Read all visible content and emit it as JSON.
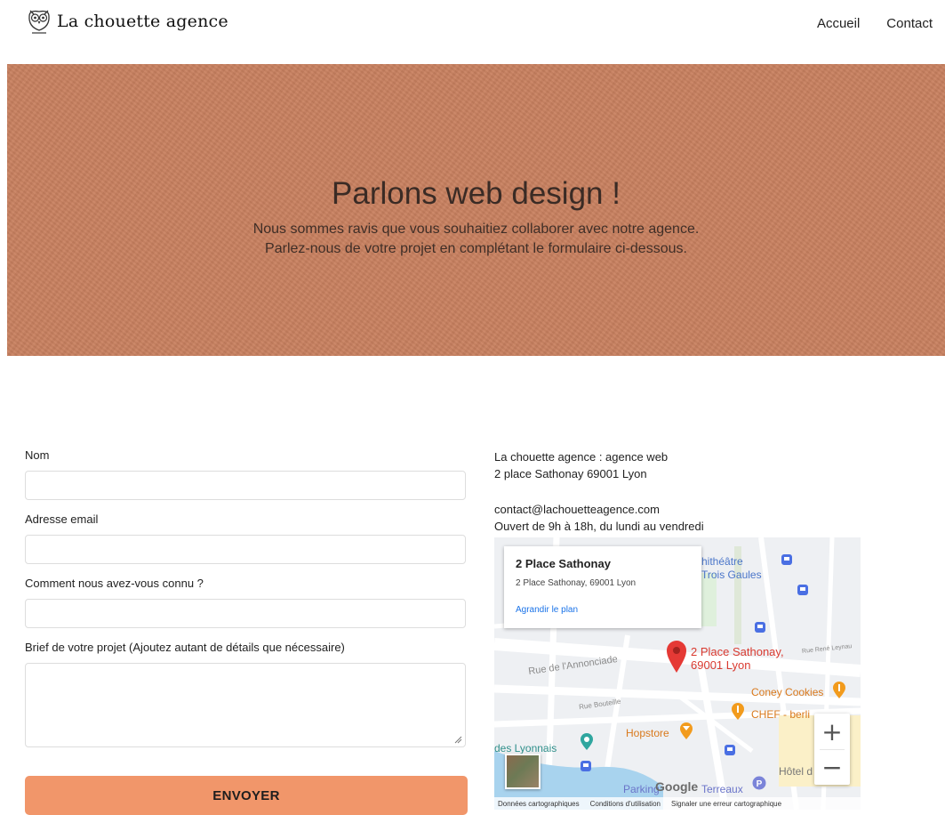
{
  "header": {
    "logo_text": "La chouette agence",
    "nav": [
      {
        "label": "Accueil"
      },
      {
        "label": "Contact"
      }
    ]
  },
  "hero": {
    "title": "Parlons web design !",
    "subtitle_line1": "Nous sommes ravis que vous souhaitiez collaborer avec notre agence.",
    "subtitle_line2": "Parlez-nous de votre projet en complétant le formulaire ci-dessous."
  },
  "form": {
    "name_label": "Nom",
    "name_value": "",
    "email_label": "Adresse email",
    "email_value": "",
    "source_label": "Comment nous avez-vous connu ?",
    "source_value": "",
    "brief_label": "Brief de votre projet (Ajoutez autant de détails que nécessaire)",
    "brief_value": "",
    "submit_label": "ENVOYER"
  },
  "info": {
    "line1": "La chouette agence : agence web",
    "line2": "2 place Sathonay 69001 Lyon",
    "email": "contact@lachouetteagence.com",
    "hours": "Ouvert de 9h à 18h, du lundi au vendredi"
  },
  "map": {
    "popup_title": "2 Place Sathonay",
    "popup_address": "2 Place Sathonay, 69001 Lyon",
    "popup_link": "Agrandir le plan",
    "marker_label_line1": "2 Place Sathonay,",
    "marker_label_line2": "69001 Lyon",
    "places": {
      "theatre_line1": "hithéâtre",
      "theatre_line2": "Trois Gaules",
      "street_annonciade": "Rue de l'Annonciade",
      "street_bouteille": "Rue Bouteille",
      "street_rene": "Rue René Leynau",
      "coney": "Coney Cookies",
      "chef": "CHEF - berli",
      "hopstore": "Hopstore",
      "lyonnais": "des Lyonnais",
      "hotel": "Hôtel d",
      "parking": "Parking",
      "terreaux": "Terreaux"
    },
    "google_label": "Google",
    "zoom_in": "+",
    "zoom_out": "−",
    "footer": {
      "data": "Données cartographiques",
      "terms": "Conditions d'utilisation",
      "report": "Signaler une erreur cartographique"
    },
    "colors": {
      "marker": "#e53935",
      "poi_orange": "#f29b1d",
      "transit": "#4a6fe3",
      "water": "#a8d3ee",
      "park": "#c8e6c9"
    }
  },
  "colors": {
    "hero_bg": "#c8805f",
    "button_bg": "#f1966a"
  }
}
